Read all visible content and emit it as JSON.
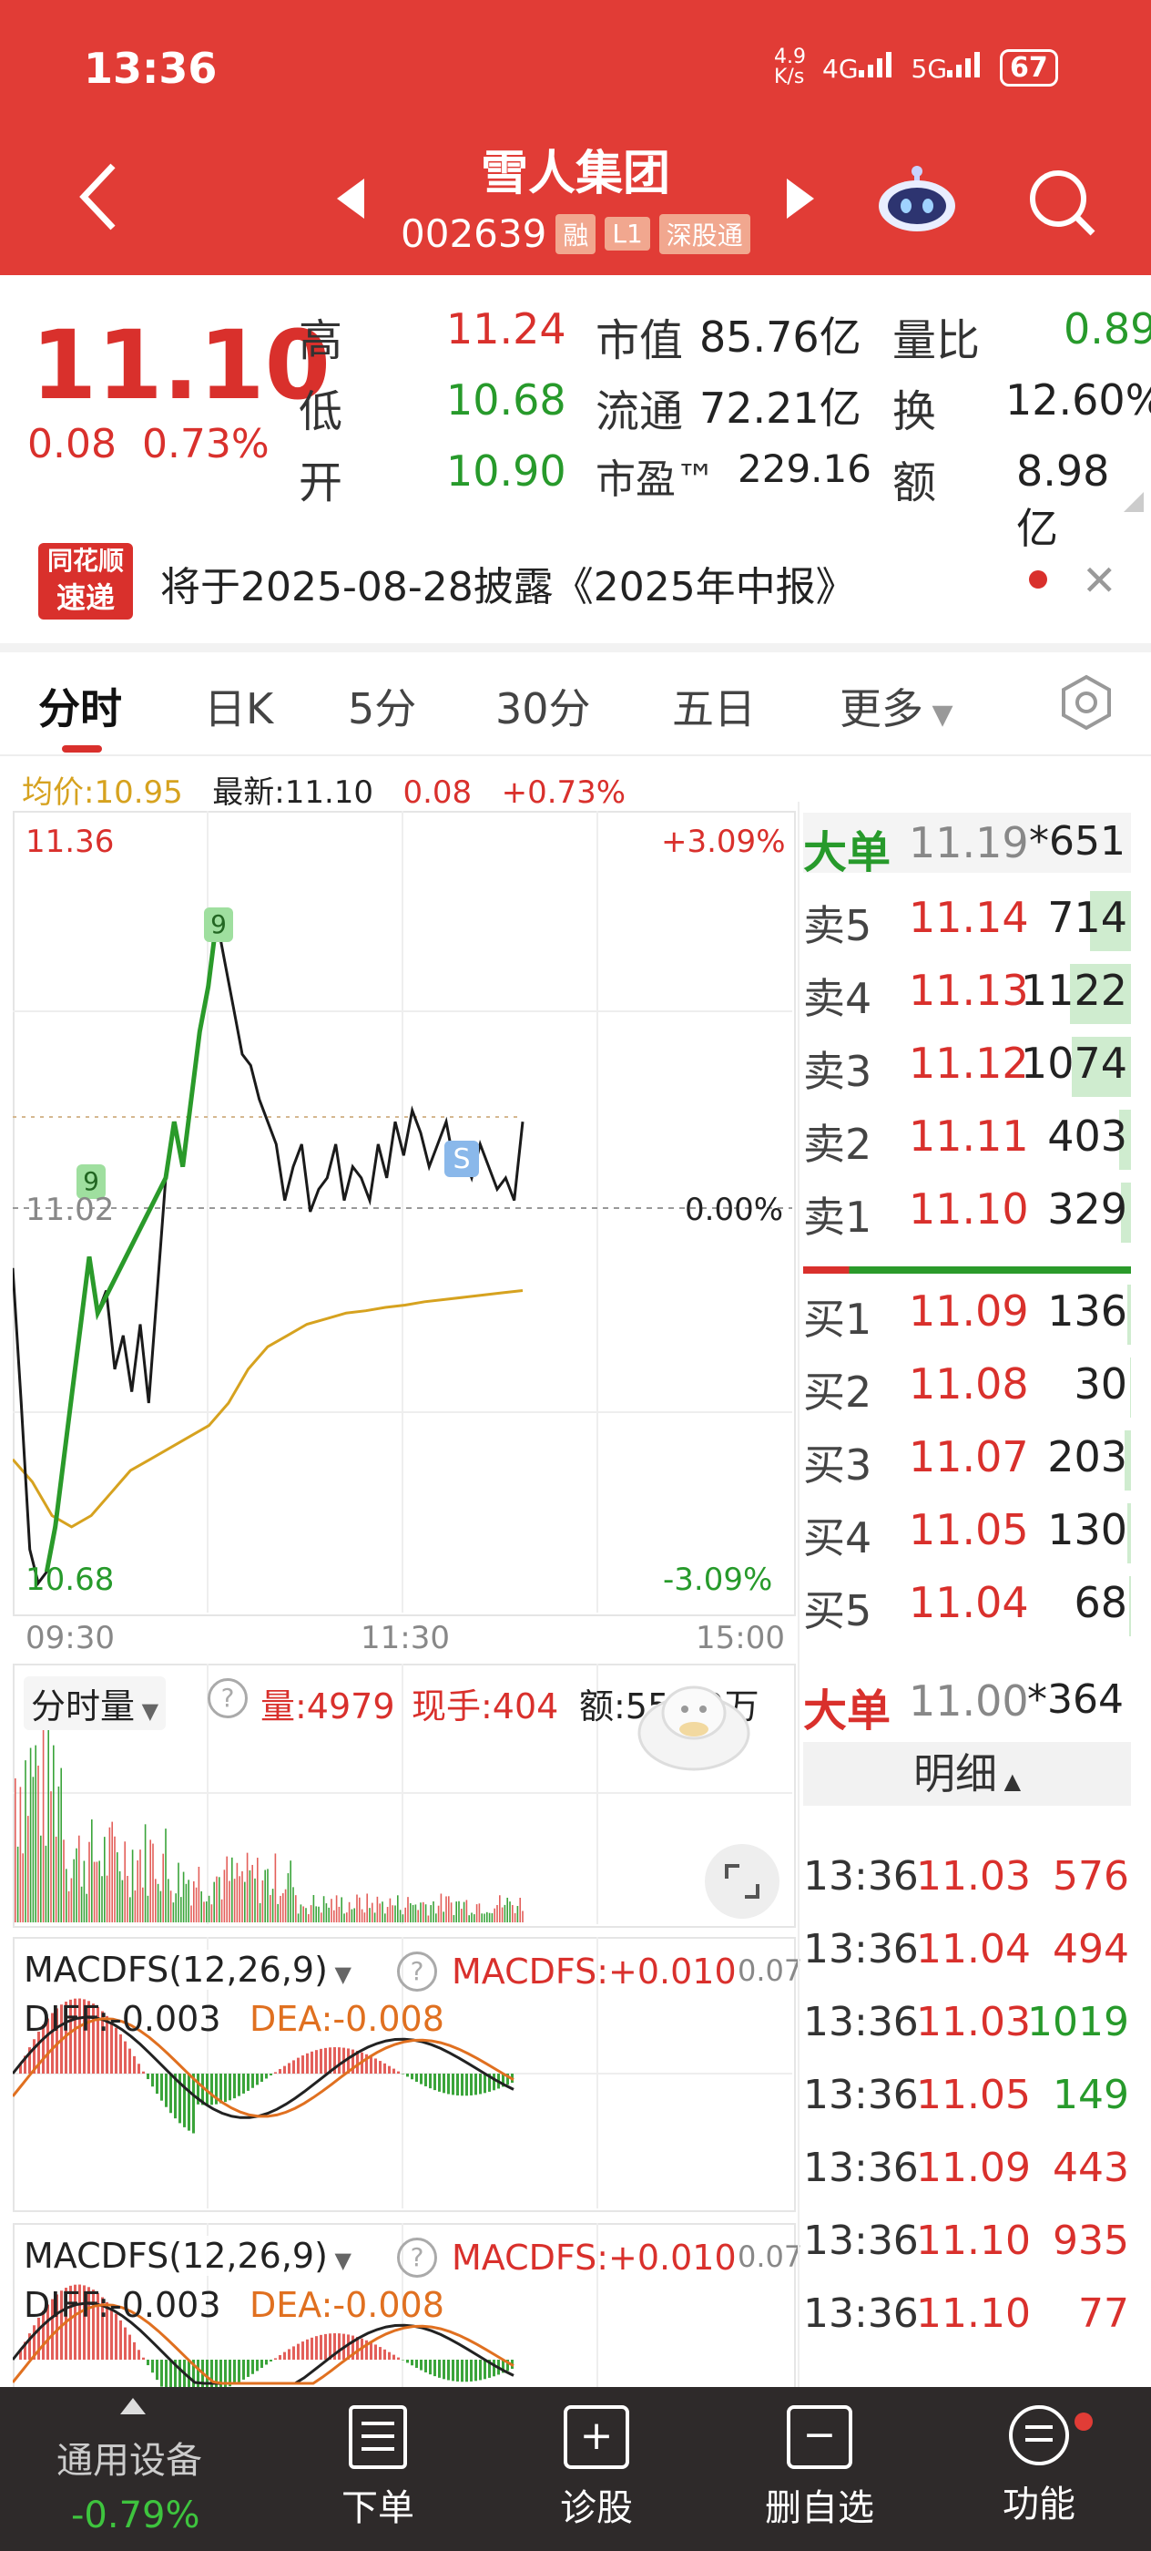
{
  "status_bar": {
    "time": "13:36",
    "net_speed": "4.9\nK/s",
    "net1": "4G",
    "net2": "5G",
    "battery": "67"
  },
  "header": {
    "stock_name": "雪人集团",
    "stock_code": "002639",
    "tags": [
      "融",
      "L1",
      "深股通"
    ]
  },
  "quote": {
    "price": "11.10",
    "change": "0.08",
    "change_pct": "0.73%",
    "stats": [
      {
        "label": "高",
        "value": "11.24"
      },
      {
        "label": "低",
        "value": "10.68"
      },
      {
        "label": "开",
        "value": "10.90"
      }
    ],
    "mid": [
      {
        "label": "市值",
        "value": "85.76亿"
      },
      {
        "label": "流通",
        "value": "72.21亿"
      },
      {
        "label": "市盈™",
        "value": "229.16"
      }
    ],
    "right": [
      {
        "label": "量比",
        "value": "0.89"
      },
      {
        "label": "换",
        "value": "12.60%"
      },
      {
        "label": "额",
        "value": "8.98亿"
      }
    ]
  },
  "news": {
    "logo_top": "同花顺",
    "logo_bottom": "速递",
    "text": "将于2025-08-28披露《2025年中报》"
  },
  "tabs": [
    "分时",
    "日K",
    "5分",
    "30分",
    "五日",
    "更多"
  ],
  "legend": {
    "avg": "均价:10.95",
    "latest": "最新:11.10",
    "change": "0.08",
    "change_pct": "+0.73%"
  },
  "chart_data": {
    "type": "line",
    "y_top": "11.36",
    "y_mid": "11.02",
    "y_bottom": "10.68",
    "pct_top": "+3.09%",
    "pct_mid": "0.00%",
    "pct_bottom": "-3.09%",
    "x_labels": [
      "09:30",
      "11:30",
      "15:00"
    ],
    "ylim": [
      10.68,
      11.36
    ],
    "series": [
      {
        "values": [
          10.97,
          10.85,
          10.72,
          10.69,
          10.7,
          10.74,
          10.8,
          10.86,
          10.92,
          10.98,
          10.93,
          10.95,
          10.88,
          10.91,
          10.86,
          10.92,
          10.85,
          10.95,
          11.05,
          11.1,
          11.06,
          11.12,
          11.18,
          11.22,
          11.28,
          11.24,
          11.2,
          11.16,
          11.15,
          11.12,
          11.1,
          11.08,
          11.03,
          11.06,
          11.08,
          11.02,
          11.04,
          11.05,
          11.08,
          11.03,
          11.06,
          11.05,
          11.03,
          11.08,
          11.05,
          11.1,
          11.07,
          11.11,
          11.09,
          11.06,
          11.08,
          11.1,
          11.06,
          11.07,
          11.05,
          11.08,
          11.06,
          11.04,
          11.05,
          11.03,
          11.1
        ]
      },
      {
        "values": [
          10.8,
          10.78,
          10.75,
          10.74,
          10.75,
          10.77,
          10.79,
          10.8,
          10.81,
          10.82,
          10.83,
          10.85,
          10.88,
          10.9,
          10.91,
          10.92,
          10.925,
          10.93,
          10.932,
          10.935,
          10.937,
          10.94,
          10.942,
          10.944,
          10.946,
          10.948,
          10.95
        ]
      }
    ],
    "markers": [
      "9",
      "9",
      "S"
    ]
  },
  "volume_panel": {
    "label": "分时量",
    "vol": "量:4979",
    "hand": "现手:404",
    "amount": "额:550.9万"
  },
  "macd1": {
    "label": "MACDFS(12,26,9)",
    "value": "MACDFS:+0.010",
    "diff": "DIFF:-0.003",
    "dea": "DEA:-0.008",
    "scale": "0.07"
  },
  "macd2": {
    "label": "MACDFS(12,26,9)",
    "value": "MACDFS:+0.010",
    "diff": "DIFF:-0.003",
    "dea": "DEA:-0.008",
    "scale": "0.07"
  },
  "order_book": {
    "big_top": {
      "label": "大单",
      "price": "11.19",
      "vol": "*651"
    },
    "asks": [
      {
        "label": "卖5",
        "price": "11.14",
        "vol": "714",
        "fill": 0.4
      },
      {
        "label": "卖4",
        "price": "11.13",
        "vol": "1122",
        "fill": 0.6
      },
      {
        "label": "卖3",
        "price": "11.12",
        "vol": "1074",
        "fill": 0.58
      },
      {
        "label": "卖2",
        "price": "11.11",
        "vol": "403",
        "fill": 0.12
      },
      {
        "label": "卖1",
        "price": "11.10",
        "vol": "329",
        "fill": 0.1
      }
    ],
    "bids": [
      {
        "label": "买1",
        "price": "11.09",
        "vol": "136",
        "fill": 0.04
      },
      {
        "label": "买2",
        "price": "11.08",
        "vol": "30",
        "fill": 0.01
      },
      {
        "label": "买3",
        "price": "11.07",
        "vol": "203",
        "fill": 0.06
      },
      {
        "label": "买4",
        "price": "11.05",
        "vol": "130",
        "fill": 0.04
      },
      {
        "label": "买5",
        "price": "11.04",
        "vol": "68",
        "fill": 0.02
      }
    ],
    "big_bottom": {
      "label": "大单",
      "price": "11.00",
      "vol": "*364"
    }
  },
  "detail": {
    "title": "明细",
    "rows": [
      {
        "time": "13:36",
        "price": "11.03",
        "vol": "576",
        "vol_color": "red"
      },
      {
        "time": "13:36",
        "price": "11.04",
        "vol": "494",
        "vol_color": "red"
      },
      {
        "time": "13:36",
        "price": "11.03",
        "vol": "1019",
        "vol_color": "green"
      },
      {
        "time": "13:36",
        "price": "11.05",
        "vol": "149",
        "vol_color": "green"
      },
      {
        "time": "13:36",
        "price": "11.09",
        "vol": "443",
        "vol_color": "red"
      },
      {
        "time": "13:36",
        "price": "11.10",
        "vol": "935",
        "vol_color": "red"
      },
      {
        "time": "13:36",
        "price": "11.10",
        "vol": "77",
        "vol_color": "red"
      }
    ]
  },
  "bottom_nav": {
    "index_name": "通用设备",
    "index_change": "-0.79%",
    "items": [
      "下单",
      "诊股",
      "删自选",
      "功能"
    ]
  }
}
